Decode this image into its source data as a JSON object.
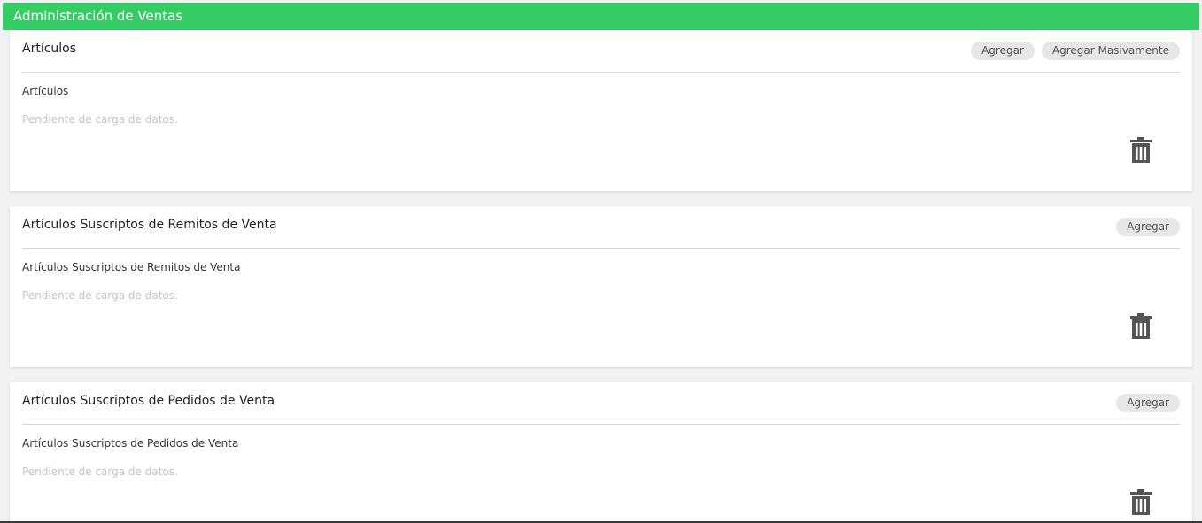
{
  "header": {
    "title": "Administración de Ventas"
  },
  "cards": [
    {
      "title": "Artículos",
      "actions": [
        "Agregar",
        "Agregar Masivamente"
      ],
      "section_label": "Artículos",
      "empty_text": "Pendiente de carga de datos."
    },
    {
      "title": "Artículos Suscriptos de Remitos de Venta",
      "actions": [
        "Agregar"
      ],
      "section_label": "Artículos Suscriptos de Remitos de Venta",
      "empty_text": "Pendiente de carga de datos."
    },
    {
      "title": "Artículos Suscriptos de Pedidos de Venta",
      "actions": [
        "Agregar"
      ],
      "section_label": "Artículos Suscriptos de Pedidos de Venta",
      "empty_text": "Pendiente de carga de datos."
    }
  ],
  "colors": {
    "header_bg": "#35cc66",
    "pill_bg": "#e7e7e7",
    "icon": "#555555"
  },
  "icons": {
    "delete": "trash-icon"
  }
}
